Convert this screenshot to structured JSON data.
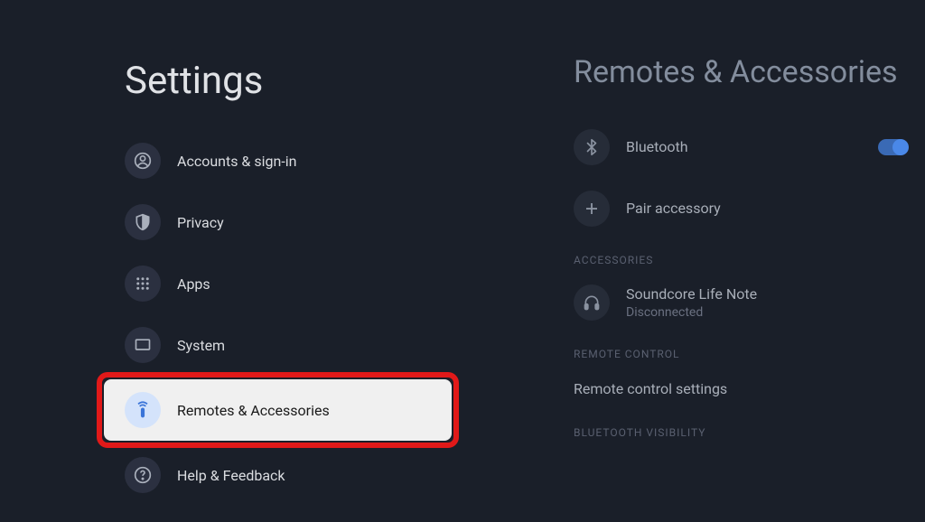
{
  "settings": {
    "title": "Settings",
    "items": [
      {
        "label": "Accounts & sign-in",
        "icon": "account-icon"
      },
      {
        "label": "Privacy",
        "icon": "shield-icon"
      },
      {
        "label": "Apps",
        "icon": "apps-icon"
      },
      {
        "label": "System",
        "icon": "monitor-icon"
      },
      {
        "label": "Remotes & Accessories",
        "icon": "remote-icon"
      },
      {
        "label": "Help & Feedback",
        "icon": "help-icon"
      }
    ]
  },
  "detail": {
    "title": "Remotes & Accessories",
    "bluetooth_label": "Bluetooth",
    "pair_label": "Pair accessory",
    "accessories_header": "ACCESSORIES",
    "accessory": {
      "name": "Soundcore Life Note",
      "status": "Disconnected"
    },
    "remote_control_header": "REMOTE CONTROL",
    "remote_settings_label": "Remote control settings",
    "bt_visibility_header": "BLUETOOTH VISIBILITY"
  }
}
